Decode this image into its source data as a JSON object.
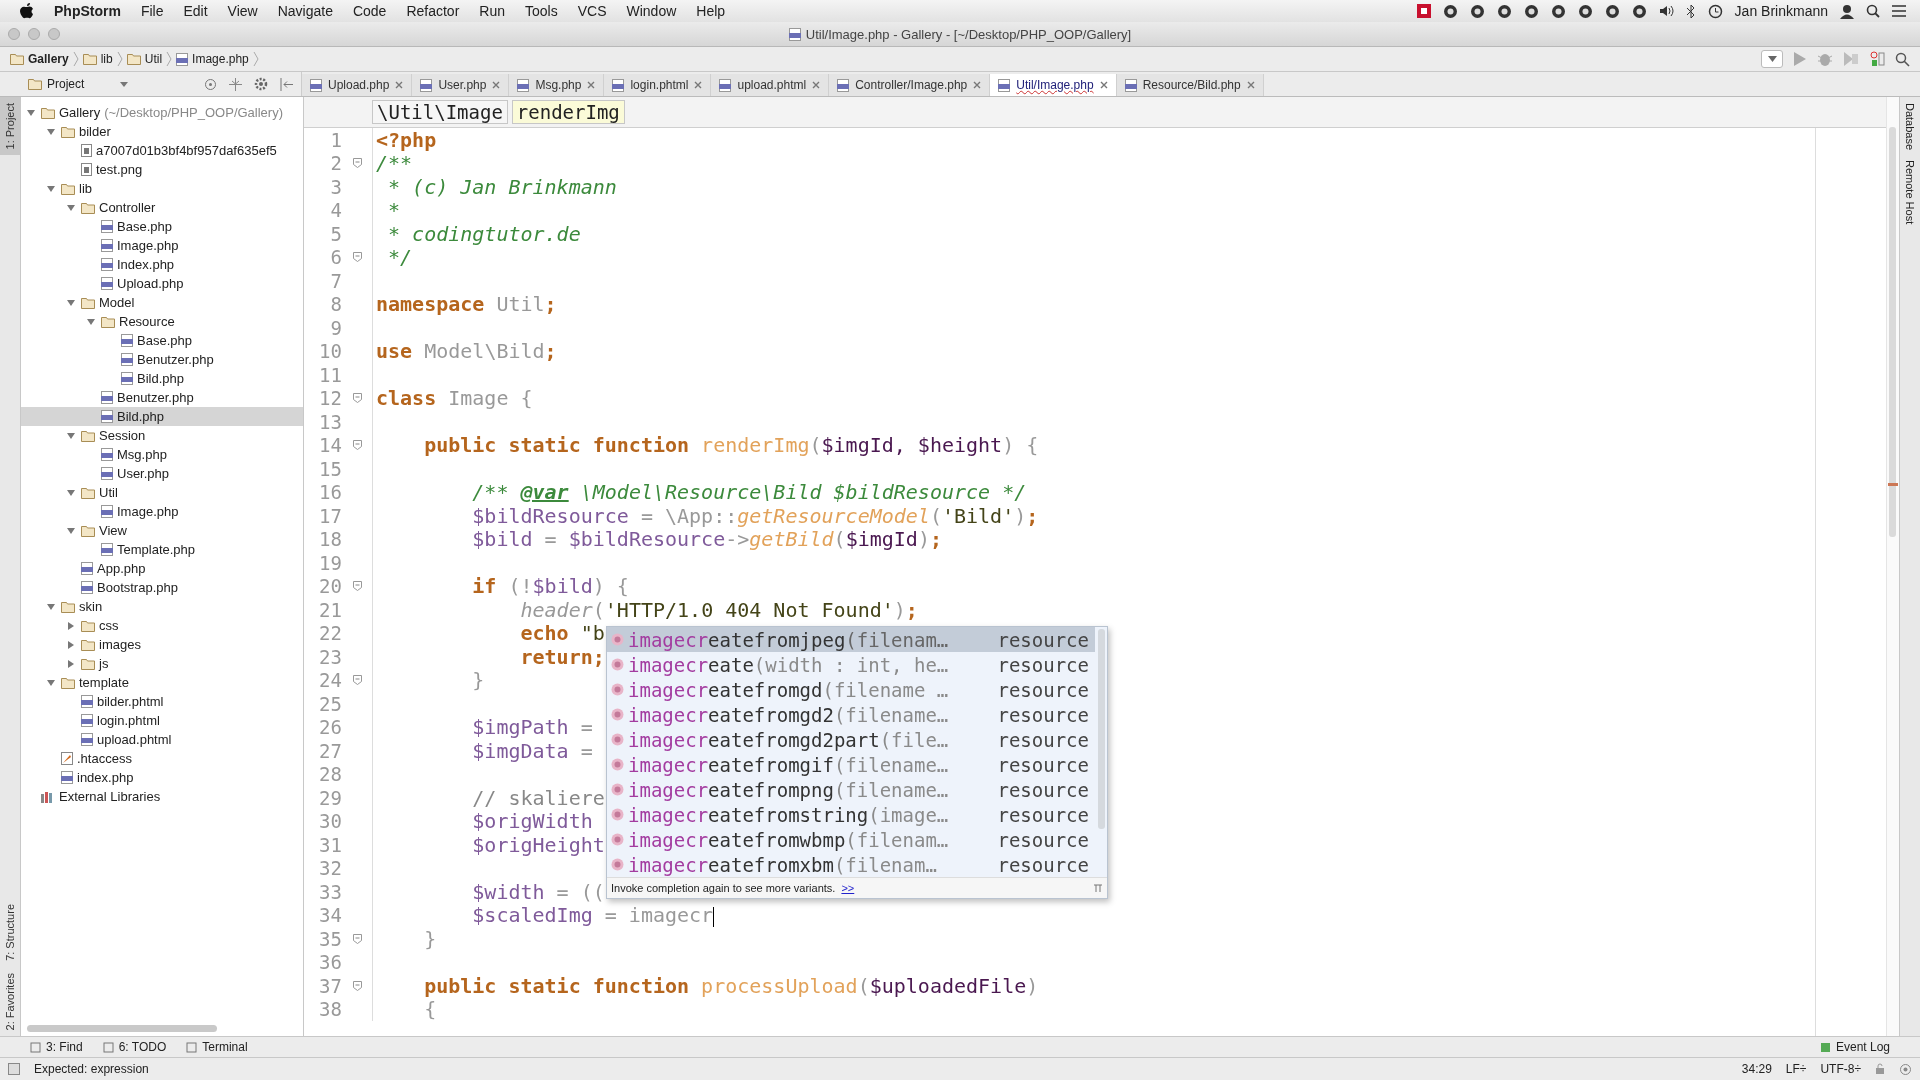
{
  "menubar": {
    "app": "PhpStorm",
    "menus": [
      "File",
      "Edit",
      "View",
      "Navigate",
      "Code",
      "Refactor",
      "Run",
      "Tools",
      "VCS",
      "Window",
      "Help"
    ],
    "user": "Jan Brinkmann"
  },
  "window": {
    "title": "Util/Image.php - Gallery - [~/Desktop/PHP_OOP/Gallery]"
  },
  "breadcrumbs": [
    {
      "label": "Gallery",
      "kind": "folder"
    },
    {
      "label": "lib",
      "kind": "folder"
    },
    {
      "label": "Util",
      "kind": "folder"
    },
    {
      "label": "Image.php",
      "kind": "php"
    }
  ],
  "left_stripe": [
    {
      "label": "1: Project",
      "selected": true
    },
    {
      "label": "7: Structure",
      "selected": false
    },
    {
      "label": "2: Favorites",
      "selected": false
    }
  ],
  "right_stripe": [
    "Database",
    "Remote Host"
  ],
  "project_panel": {
    "title": "Project"
  },
  "tabs": [
    {
      "label": "Upload.php",
      "selected": false
    },
    {
      "label": "User.php",
      "selected": false
    },
    {
      "label": "Msg.php",
      "selected": false
    },
    {
      "label": "login.phtml",
      "selected": false
    },
    {
      "label": "upload.phtml",
      "selected": false
    },
    {
      "label": "Controller/Image.php",
      "selected": false
    },
    {
      "label": "Util/Image.php",
      "selected": true
    },
    {
      "label": "Resource/Bild.php",
      "selected": false
    }
  ],
  "tree": [
    {
      "label": "Gallery",
      "hint": "(~/Desktop/PHP_OOP/Gallery)",
      "kind": "folder",
      "expanded": true,
      "selected": false,
      "children": [
        {
          "label": "bilder",
          "kind": "folder",
          "expanded": true,
          "selected": false,
          "children": [
            {
              "label": "a7007d01b3bf4bf957daf635ef5",
              "kind": "file",
              "selected": false
            },
            {
              "label": "test.png",
              "kind": "file",
              "selected": false
            }
          ]
        },
        {
          "label": "lib",
          "kind": "folder",
          "expanded": true,
          "selected": false,
          "children": [
            {
              "label": "Controller",
              "kind": "folder",
              "expanded": true,
              "selected": false,
              "children": [
                {
                  "label": "Base.php",
                  "kind": "php",
                  "selected": false
                },
                {
                  "label": "Image.php",
                  "kind": "php",
                  "selected": false
                },
                {
                  "label": "Index.php",
                  "kind": "php",
                  "selected": false
                },
                {
                  "label": "Upload.php",
                  "kind": "php",
                  "selected": false
                }
              ]
            },
            {
              "label": "Model",
              "kind": "folder",
              "expanded": true,
              "selected": false,
              "children": [
                {
                  "label": "Resource",
                  "kind": "folder",
                  "expanded": true,
                  "selected": false,
                  "children": [
                    {
                      "label": "Base.php",
                      "kind": "php",
                      "selected": false
                    },
                    {
                      "label": "Benutzer.php",
                      "kind": "php",
                      "selected": false
                    },
                    {
                      "label": "Bild.php",
                      "kind": "php",
                      "selected": false
                    }
                  ]
                },
                {
                  "label": "Benutzer.php",
                  "kind": "php",
                  "selected": false
                },
                {
                  "label": "Bild.php",
                  "kind": "php",
                  "selected": true
                }
              ]
            },
            {
              "label": "Session",
              "kind": "folder",
              "expanded": true,
              "selected": false,
              "children": [
                {
                  "label": "Msg.php",
                  "kind": "php",
                  "selected": false
                },
                {
                  "label": "User.php",
                  "kind": "php",
                  "selected": false
                }
              ]
            },
            {
              "label": "Util",
              "kind": "folder",
              "expanded": true,
              "selected": false,
              "children": [
                {
                  "label": "Image.php",
                  "kind": "php",
                  "selected": false
                }
              ]
            },
            {
              "label": "View",
              "kind": "folder",
              "expanded": true,
              "selected": false,
              "children": [
                {
                  "label": "Template.php",
                  "kind": "php",
                  "selected": false
                }
              ]
            },
            {
              "label": "App.php",
              "kind": "php",
              "selected": false
            },
            {
              "label": "Bootstrap.php",
              "kind": "php",
              "selected": false
            }
          ]
        },
        {
          "label": "skin",
          "kind": "folder",
          "expanded": true,
          "selected": false,
          "children": [
            {
              "label": "css",
              "kind": "folder",
              "expanded": false,
              "selected": false
            },
            {
              "label": "images",
              "kind": "folder",
              "expanded": false,
              "selected": false
            },
            {
              "label": "js",
              "kind": "folder",
              "expanded": false,
              "selected": false
            }
          ]
        },
        {
          "label": "template",
          "kind": "folder",
          "expanded": true,
          "selected": false,
          "children": [
            {
              "label": "bilder.phtml",
              "kind": "php",
              "selected": false
            },
            {
              "label": "login.phtml",
              "kind": "php",
              "selected": false
            },
            {
              "label": "upload.phtml",
              "kind": "php",
              "selected": false
            }
          ]
        },
        {
          "label": ".htaccess",
          "kind": "htaccess",
          "selected": false
        },
        {
          "label": "index.php",
          "kind": "php",
          "selected": false
        }
      ]
    },
    {
      "label": "External Libraries",
      "kind": "library",
      "selected": false
    }
  ],
  "editor": {
    "path": [
      {
        "label": "\\Util\\Image",
        "selected": false
      },
      {
        "label": "renderImg",
        "selected": true
      }
    ],
    "lines": [
      {
        "number": "1",
        "fold": false,
        "tokens": [
          {
            "kind": "kw",
            "text": "<?php"
          }
        ]
      },
      {
        "number": "2",
        "fold": true,
        "tokens": [
          {
            "kind": "comment",
            "text": "/**"
          }
        ]
      },
      {
        "number": "3",
        "fold": false,
        "tokens": [
          {
            "kind": "comment",
            "text": " * (c) Jan Brinkmann"
          }
        ]
      },
      {
        "number": "4",
        "fold": false,
        "tokens": [
          {
            "kind": "comment",
            "text": " *"
          }
        ]
      },
      {
        "number": "5",
        "fold": false,
        "tokens": [
          {
            "kind": "comment",
            "text": " * codingtutor.de"
          }
        ]
      },
      {
        "number": "6",
        "fold": true,
        "tokens": [
          {
            "kind": "comment",
            "text": " */"
          }
        ]
      },
      {
        "number": "7",
        "fold": false
      },
      {
        "number": "8",
        "fold": false,
        "tokens": [
          {
            "kind": "kw",
            "text": "namespace "
          },
          {
            "kind": "dim",
            "text": "Util"
          },
          {
            "kind": "kw",
            "text": ";"
          }
        ]
      },
      {
        "number": "9",
        "fold": false
      },
      {
        "number": "10",
        "fold": false,
        "tokens": [
          {
            "kind": "kw",
            "text": "use "
          },
          {
            "kind": "dim",
            "text": "Model\\Bild"
          },
          {
            "kind": "kw",
            "text": ";"
          }
        ]
      },
      {
        "number": "11",
        "fold": false
      },
      {
        "number": "12",
        "fold": true,
        "tokens": [
          {
            "kind": "kw",
            "text": "class "
          },
          {
            "kind": "dim",
            "text": "Image {"
          }
        ]
      },
      {
        "number": "13",
        "fold": false
      },
      {
        "number": "14",
        "fold": true,
        "tokens": [
          {
            "kind": "kw",
            "text": "    public static function "
          },
          {
            "kind": "fn",
            "text": "renderImg"
          },
          {
            "kind": "dim",
            "text": "("
          },
          {
            "kind": "param",
            "text": "$imgId, $height"
          },
          {
            "kind": "dim",
            "text": ") {"
          }
        ]
      },
      {
        "number": "15",
        "fold": false
      },
      {
        "number": "16",
        "fold": false,
        "tokens": [
          {
            "kind": "comment",
            "text": "        /** "
          },
          {
            "kind": "doctag",
            "text": "@var"
          },
          {
            "kind": "comment",
            "text": " \\Model\\Resource\\Bild $bildResource */"
          }
        ]
      },
      {
        "number": "17",
        "fold": false,
        "tokens": [
          {
            "kind": "var",
            "text": "        $bildResource"
          },
          {
            "kind": "dim",
            "text": " = \\App::"
          },
          {
            "kind": "call",
            "text": "getResourceModel"
          },
          {
            "kind": "dim",
            "text": "("
          },
          {
            "kind": "str",
            "text": "'Bild'"
          },
          {
            "kind": "dim",
            "text": ")"
          },
          {
            "kind": "kw",
            "text": ";"
          }
        ]
      },
      {
        "number": "18",
        "fold": false,
        "tokens": [
          {
            "kind": "var",
            "text": "        $bild"
          },
          {
            "kind": "dim",
            "text": " = "
          },
          {
            "kind": "var",
            "text": "$bildResource"
          },
          {
            "kind": "dim",
            "text": "->"
          },
          {
            "kind": "call",
            "text": "getBild"
          },
          {
            "kind": "dim",
            "text": "("
          },
          {
            "kind": "param",
            "text": "$imgId"
          },
          {
            "kind": "dim",
            "text": ")"
          },
          {
            "kind": "kw",
            "text": ";"
          }
        ]
      },
      {
        "number": "19",
        "fold": false
      },
      {
        "number": "20",
        "fold": true,
        "tokens": [
          {
            "kind": "kw",
            "text": "        if "
          },
          {
            "kind": "dim",
            "text": "(!"
          },
          {
            "kind": "var",
            "text": "$bild"
          },
          {
            "kind": "dim",
            "text": ") {"
          }
        ]
      },
      {
        "number": "21",
        "fold": false,
        "tokens": [
          {
            "kind": "builtin",
            "text": "            header"
          },
          {
            "kind": "dim",
            "text": "("
          },
          {
            "kind": "str",
            "text": "'HTTP/1.0 404 Not Found'"
          },
          {
            "kind": "dim",
            "text": ")"
          },
          {
            "kind": "kw",
            "text": ";"
          }
        ]
      },
      {
        "number": "22",
        "fold": false,
        "tokens": [
          {
            "kind": "kw",
            "text": "            echo "
          },
          {
            "kind": "str",
            "text": "\"b"
          }
        ]
      },
      {
        "number": "23",
        "fold": false,
        "tokens": [
          {
            "kind": "kw",
            "text": "            return;"
          }
        ]
      },
      {
        "number": "24",
        "fold": true,
        "tokens": [
          {
            "kind": "dim",
            "text": "        }"
          }
        ]
      },
      {
        "number": "25",
        "fold": false
      },
      {
        "number": "26",
        "fold": false,
        "tokens": [
          {
            "kind": "var",
            "text": "        $imgPath"
          },
          {
            "kind": "dim",
            "text": " ="
          }
        ]
      },
      {
        "number": "27",
        "fold": false,
        "tokens": [
          {
            "kind": "var",
            "text": "        $imgData"
          },
          {
            "kind": "dim",
            "text": " ="
          }
        ]
      },
      {
        "number": "28",
        "fold": false
      },
      {
        "number": "29",
        "fold": false,
        "tokens": [
          {
            "kind": "linecomment",
            "text": "        // skaliere"
          }
        ]
      },
      {
        "number": "30",
        "fold": false,
        "tokens": [
          {
            "kind": "var",
            "text": "        $origWidth"
          }
        ]
      },
      {
        "number": "31",
        "fold": false,
        "tokens": [
          {
            "kind": "var",
            "text": "        $origHeight"
          }
        ]
      },
      {
        "number": "32",
        "fold": false
      },
      {
        "number": "33",
        "fold": false,
        "tokens": [
          {
            "kind": "var",
            "text": "        $width"
          },
          {
            "kind": "dim",
            "text": " = (("
          }
        ]
      },
      {
        "number": "34",
        "fold": false,
        "caret": true,
        "tokens": [
          {
            "kind": "var",
            "text": "        $scaledImg"
          },
          {
            "kind": "dim",
            "text": " = imagecr"
          }
        ]
      },
      {
        "number": "35",
        "fold": true,
        "tokens": [
          {
            "kind": "dim",
            "text": "    }"
          }
        ]
      },
      {
        "number": "36",
        "fold": false
      },
      {
        "number": "37",
        "fold": true,
        "tokens": [
          {
            "kind": "kw",
            "text": "    public static function "
          },
          {
            "kind": "fn",
            "text": "processUpload"
          },
          {
            "kind": "dim",
            "text": "("
          },
          {
            "kind": "param",
            "text": "$uploadedFile"
          },
          {
            "kind": "dim",
            "text": ")"
          }
        ]
      },
      {
        "number": "38",
        "fold": false,
        "tokens": [
          {
            "kind": "dim",
            "text": "    {"
          }
        ]
      }
    ]
  },
  "completion": {
    "items": [
      {
        "match": "imagecr",
        "rest": "eatefromjpeg",
        "params": "(filenam…",
        "type": "resource",
        "selected": true
      },
      {
        "match": "imagecr",
        "rest": "eate",
        "params": "(width : int, he…",
        "type": "resource",
        "selected": false
      },
      {
        "match": "imagecr",
        "rest": "eatefromgd",
        "params": "(filename …",
        "type": "resource",
        "selected": false
      },
      {
        "match": "imagecr",
        "rest": "eatefromgd2",
        "params": "(filename…",
        "type": "resource",
        "selected": false
      },
      {
        "match": "imagecr",
        "rest": "eatefromgd2part",
        "params": "(file…",
        "type": "resource",
        "selected": false
      },
      {
        "match": "imagecr",
        "rest": "eatefromgif",
        "params": "(filename…",
        "type": "resource",
        "selected": false
      },
      {
        "match": "imagecr",
        "rest": "eatefrompng",
        "params": "(filename…",
        "type": "resource",
        "selected": false
      },
      {
        "match": "imagecr",
        "rest": "eatefromstring",
        "params": "(image…",
        "type": "resource",
        "selected": false
      },
      {
        "match": "imagecr",
        "rest": "eatefromwbmp",
        "params": "(filenam…",
        "type": "resource",
        "selected": false
      },
      {
        "match": "imagecr",
        "rest": "eatefromxbm",
        "params": "(filenam…",
        "type": "resource",
        "selected": false
      }
    ],
    "hint": "Invoke completion again to see more variants.",
    "more": ">>"
  },
  "tool_tabs": [
    "3: Find",
    "6: TODO",
    "Terminal"
  ],
  "event_log": "Event Log",
  "status_bar": {
    "message": "Expected: expression",
    "position": "34:29",
    "line_sep": "LF÷",
    "encoding": "UTF-8÷"
  }
}
